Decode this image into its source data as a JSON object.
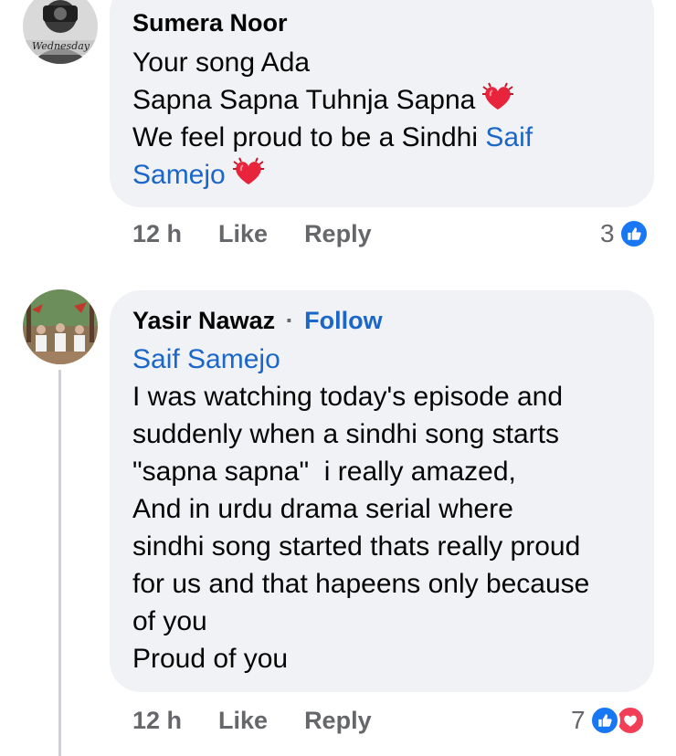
{
  "comments": [
    {
      "author": "Sumera Noor",
      "avatar_caption": "Wednesday",
      "lines": [
        {
          "text": "Your song Ada"
        },
        {
          "text": "Sapna Sapna Tuhnja Sapna",
          "emoji": "beating-heart"
        },
        {
          "text": "We feel proud to be a Sindhi ",
          "mention": "Saif"
        },
        {
          "mention": "Samejo",
          "emoji": "beating-heart"
        }
      ],
      "time": "12 h",
      "like_label": "Like",
      "reply_label": "Reply",
      "reaction_count": "3",
      "reactions": [
        "like"
      ]
    },
    {
      "author": "Yasir Nawaz",
      "follow_label": "Follow",
      "separator": "·",
      "lines": [
        {
          "mention": "Saif Samejo"
        },
        {
          "text": "I was watching today's episode and"
        },
        {
          "text": "suddenly when a sindhi song starts"
        },
        {
          "text": "\"sapna sapna\"  i really amazed,"
        },
        {
          "text": "And in urdu drama serial where"
        },
        {
          "text": "sindhi song started thats really proud"
        },
        {
          "text": "for us and that hapeens only because"
        },
        {
          "text": "of you"
        },
        {
          "text": "Proud of you"
        }
      ],
      "time": "12 h",
      "like_label": "Like",
      "reply_label": "Reply",
      "reaction_count": "7",
      "reactions": [
        "like",
        "love"
      ]
    }
  ],
  "colors": {
    "bubble": "#f0f2f5",
    "mention": "#1b66c9",
    "meta": "#65676b",
    "like_blue": "#1877f2",
    "love_red": "#f33e58"
  }
}
